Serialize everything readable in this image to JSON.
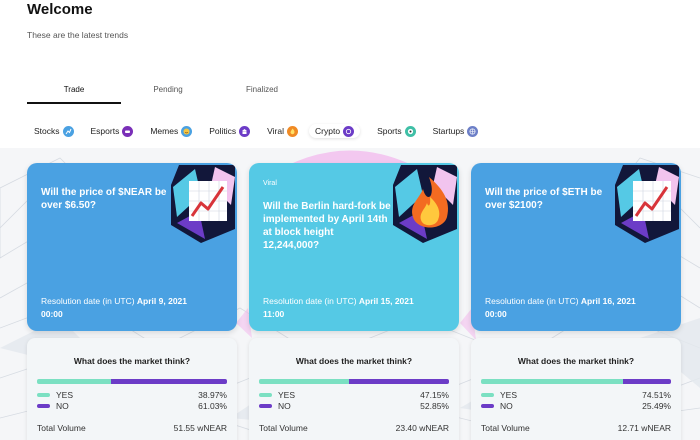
{
  "header": {
    "title": "Welcome",
    "subtitle": "These are the latest trends"
  },
  "tabs": [
    {
      "label": "Trade",
      "active": true
    },
    {
      "label": "Pending",
      "active": false
    },
    {
      "label": "Finalized",
      "active": false
    }
  ],
  "categories": [
    {
      "label": "Stocks",
      "icon": "chart-emoji-icon",
      "color": "#4aa1e2"
    },
    {
      "label": "Esports",
      "icon": "game-emoji-icon",
      "color": "#7a2fb8"
    },
    {
      "label": "Memes",
      "icon": "face-emoji-icon",
      "color": "#4aa1e2"
    },
    {
      "label": "Politics",
      "icon": "building-emoji-icon",
      "color": "#6c3cc7"
    },
    {
      "label": "Viral",
      "icon": "fire-emoji-icon",
      "color": "#f08a24"
    },
    {
      "label": "Crypto",
      "icon": "coin-emoji-icon",
      "color": "#6c3cc7"
    },
    {
      "label": "Sports",
      "icon": "ball-emoji-icon",
      "color": "#3fbfa6"
    },
    {
      "label": "Startups",
      "icon": "globe-emoji-icon",
      "color": "#6c7fc7"
    }
  ],
  "markets": [
    {
      "tag": "",
      "question": "Will the price of $NEAR be over $6.50?",
      "resolution_label": "Resolution date (in UTC)",
      "resolution_date": "April 9, 2021",
      "resolution_time": "00:00",
      "thumb_icon": "chart-up-icon",
      "card_color": "#4aa1e2",
      "panel_title": "What does the market think?",
      "yes_label": "YES",
      "yes_value": "38.97%",
      "yes_fraction": 0.3897,
      "no_label": "NO",
      "no_value": "61.03%",
      "volume_label": "Total Volume",
      "volume_value": "51.55 wNEAR"
    },
    {
      "tag": "Viral",
      "question": "Will the Berlin hard-fork be implemented by April 14th at block height 12,244,000?",
      "resolution_label": "Resolution date (in UTC)",
      "resolution_date": "April 15, 2021",
      "resolution_time": "11:00",
      "thumb_icon": "fire-icon",
      "card_color": "#55c9e5",
      "panel_title": "What does the market think?",
      "yes_label": "YES",
      "yes_value": "47.15%",
      "yes_fraction": 0.4715,
      "no_label": "NO",
      "no_value": "52.85%",
      "volume_label": "Total Volume",
      "volume_value": "23.40 wNEAR"
    },
    {
      "tag": "",
      "question": "Will the price of $ETH be over $2100?",
      "resolution_label": "Resolution date (in UTC)",
      "resolution_date": "April 16, 2021",
      "resolution_time": "00:00",
      "thumb_icon": "chart-up-icon",
      "card_color": "#4aa1e2",
      "panel_title": "What does the market think?",
      "yes_label": "YES",
      "yes_value": "74.51%",
      "yes_fraction": 0.7451,
      "no_label": "NO",
      "no_value": "25.49%",
      "volume_label": "Total Volume",
      "volume_value": "12.71 wNEAR"
    }
  ],
  "colors": {
    "yes": "#7be0c2",
    "no": "#6c3cc7",
    "accent_pink": "#f2c4ee"
  }
}
